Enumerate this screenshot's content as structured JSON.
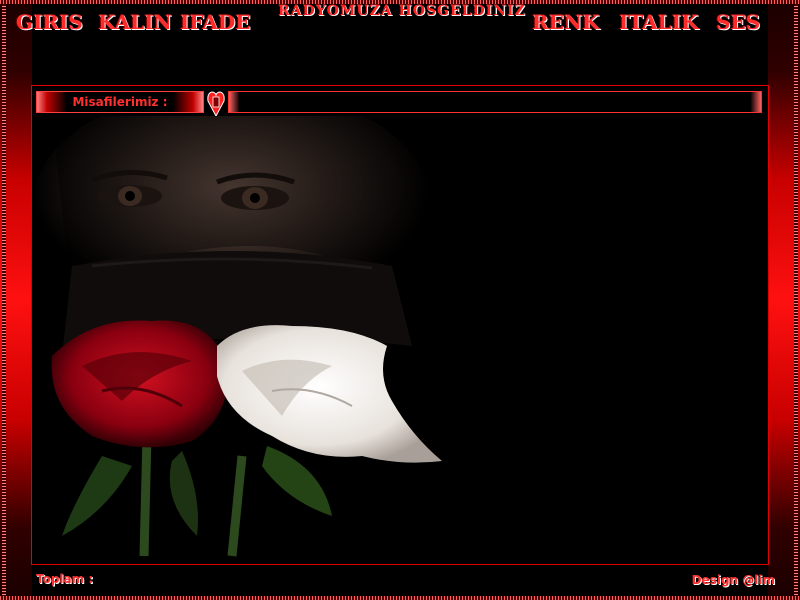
{
  "header": {
    "title": "RADYOMUZA HOSGELDINIZ",
    "menu_left": [
      {
        "id": "giris",
        "label": "GIRIS"
      },
      {
        "id": "kalin",
        "label": "KALIN"
      },
      {
        "id": "ifade",
        "label": "IFADE"
      }
    ],
    "menu_right": [
      {
        "id": "renk",
        "label": "RENK"
      },
      {
        "id": "italik",
        "label": "ITALIK"
      },
      {
        "id": "ses",
        "label": "SES"
      }
    ]
  },
  "guests": {
    "label": "Misafilerimiz :"
  },
  "footer": {
    "total_label": "Toplam :",
    "credit": "Design @lim"
  },
  "colors": {
    "accent": "#ff2020",
    "border": "#e00000",
    "background": "#000000"
  },
  "icons": {
    "separator": "heart-icon"
  }
}
